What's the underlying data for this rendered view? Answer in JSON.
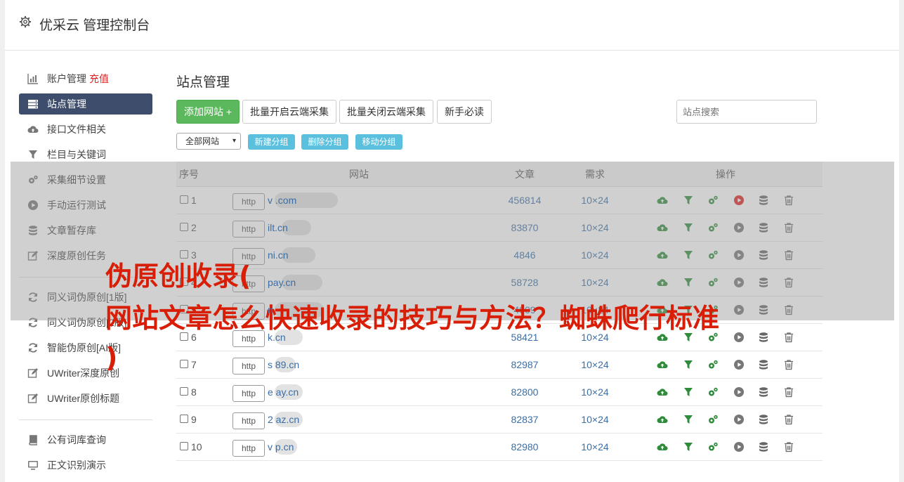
{
  "header": {
    "title": "优采云 管理控制台"
  },
  "sidebar": {
    "group1": [
      {
        "label": "账户管理",
        "extra": "充值",
        "icon": "bar-chart-icon"
      },
      {
        "label": "站点管理",
        "icon": "server-icon",
        "active": true
      },
      {
        "label": "接口文件相关",
        "icon": "cloud-upload-icon"
      },
      {
        "label": "栏目与关键词",
        "icon": "filter-icon"
      },
      {
        "label": "采集细节设置",
        "icon": "gears-icon"
      },
      {
        "label": "手动运行测试",
        "icon": "play-circle-icon"
      },
      {
        "label": "文章暂存库",
        "icon": "database-icon"
      },
      {
        "label": "深度原创任务",
        "icon": "edit-icon"
      }
    ],
    "group2": [
      {
        "label": "同义词伪原创[1版]",
        "icon": "refresh-icon"
      },
      {
        "label": "同义词伪原创[2版]",
        "icon": "refresh-icon"
      },
      {
        "label": "智能伪原创[AI版]",
        "icon": "refresh-icon"
      },
      {
        "label": "UWriter深度原创",
        "icon": "edit-icon"
      },
      {
        "label": "UWriter原创标题",
        "icon": "edit-icon"
      }
    ],
    "group3": [
      {
        "label": "公有词库查询",
        "icon": "book-icon"
      },
      {
        "label": "正文识别演示",
        "icon": "monitor-icon"
      }
    ]
  },
  "main": {
    "title": "站点管理",
    "buttons": {
      "add_site": "添加网站 +",
      "batch_open": "批量开启云端采集",
      "batch_close": "批量关闭云端采集",
      "newbie": "新手必读"
    },
    "search_placeholder": "站点搜索",
    "group_select": "全部网站",
    "group_buttons": {
      "new": "新建分组",
      "delete": "删除分组",
      "move": "移动分组"
    },
    "table": {
      "headers": {
        "no": "序号",
        "site": "网站",
        "articles": "文章",
        "demand": "需求",
        "ops": "操作"
      },
      "rows": [
        {
          "no": "1",
          "prefix": "http",
          "site": "v                .com",
          "articles": "456814",
          "demand": "10×24",
          "run_active": true
        },
        {
          "no": "2",
          "prefix": "http",
          "site": "        ilt.cn",
          "articles": "83870",
          "demand": "10×24"
        },
        {
          "no": "3",
          "prefix": "http",
          "site": "         ni.cn",
          "articles": "4846",
          "demand": "10×24"
        },
        {
          "no": "4",
          "prefix": "http",
          "site": "          pay.cn",
          "articles": "58728",
          "demand": "10×24"
        },
        {
          "no": "5",
          "prefix": "http",
          "site": "            n",
          "articles": "4909",
          "demand": "10×24"
        },
        {
          "no": "6",
          "prefix": "http",
          "site": "        k.cn",
          "articles": "58421",
          "demand": "10×24"
        },
        {
          "no": "7",
          "prefix": "http",
          "site": "s    89.cn",
          "articles": "82987",
          "demand": "10×24"
        },
        {
          "no": "8",
          "prefix": "http",
          "site": "e       ay.cn",
          "articles": "82800",
          "demand": "10×24"
        },
        {
          "no": "9",
          "prefix": "http",
          "site": "2        az.cn",
          "articles": "82837",
          "demand": "10×24"
        },
        {
          "no": "10",
          "prefix": "http",
          "site": "v       p.cn",
          "articles": "82980",
          "demand": "10×24"
        }
      ]
    }
  },
  "watermark": {
    "line1": "伪原创收录(",
    "line2": "网站文章怎么快速收录的技巧与方法？蜘蛛爬行标准",
    "line3": ")"
  },
  "colors": {
    "accent_green": "#5cb85c",
    "info_blue": "#5bc0de",
    "active_nav": "#3d4d6b",
    "link_blue": "#3a6ea5",
    "watermark_red": "#d81e06"
  }
}
